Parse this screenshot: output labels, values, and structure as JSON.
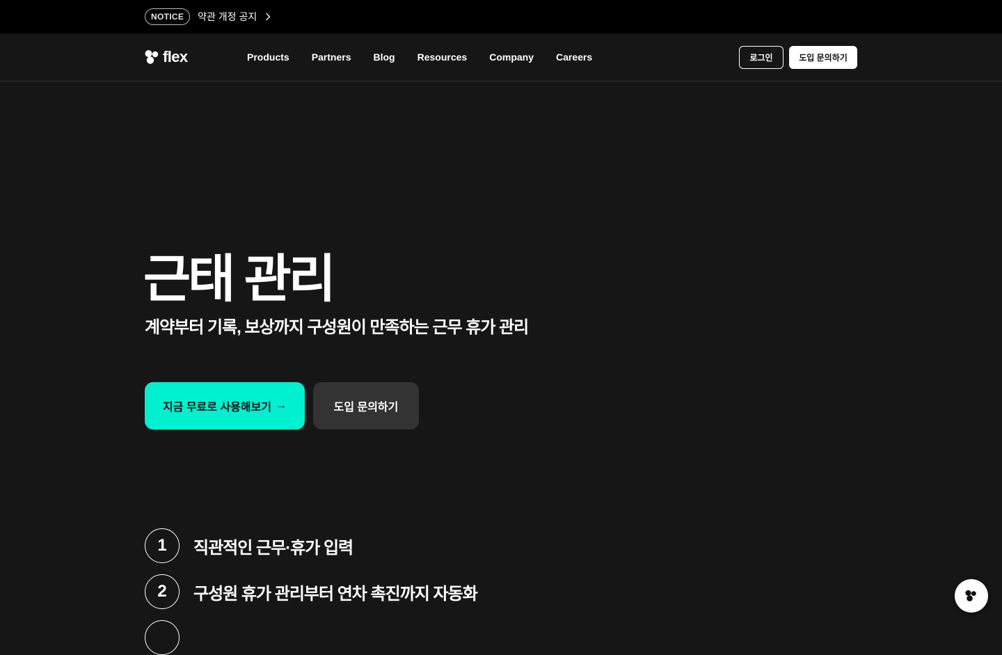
{
  "notice": {
    "badge": "NOTICE",
    "text": "약관 개정 공지",
    "icon": "chevron-right-icon"
  },
  "nav": {
    "logo_text": "flex",
    "links": [
      "Products",
      "Partners",
      "Blog",
      "Resources",
      "Company",
      "Careers"
    ],
    "login": "로그인",
    "inquiry": "도입 문의하기"
  },
  "hero": {
    "title": "근태 관리",
    "subtitle": "계약부터 기록, 보상까지 구성원이 만족하는 근무 휴가 관리",
    "primary_cta": "지금 무료로 사용해보기",
    "primary_cta_arrow": "→",
    "secondary_cta": "도입 문의하기"
  },
  "features": [
    {
      "num": "1",
      "text": "직관적인 근무·휴가 입력"
    },
    {
      "num": "2",
      "text": "구성원 휴가 관리부터 연차 촉진까지 자동화"
    }
  ],
  "colors": {
    "background": "#161616",
    "notice_bar": "#000000",
    "accent": "#00f0d0",
    "secondary_button": "#333333"
  }
}
